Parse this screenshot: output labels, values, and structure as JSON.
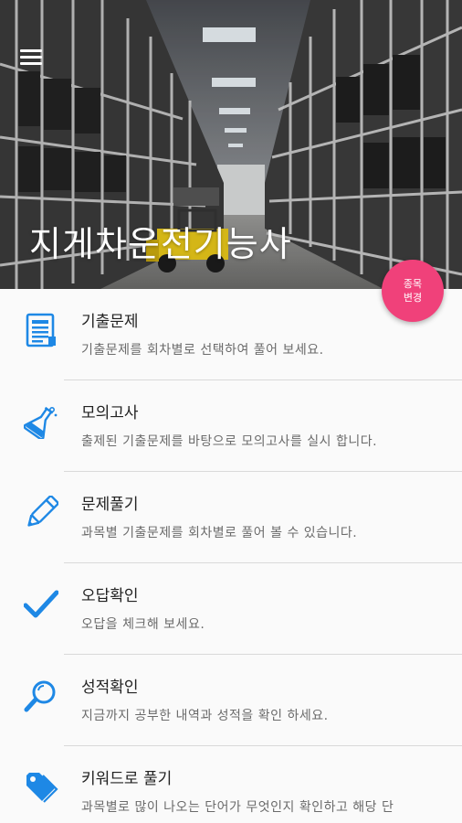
{
  "header": {
    "title": "지게차운전기능사",
    "menu_icon": "hamburger-menu-icon"
  },
  "fab": {
    "line1": "종목",
    "line2": "변경",
    "color": "#f0417a"
  },
  "accent_color": "#1e88e5",
  "menu_items": [
    {
      "title": "기출문제",
      "desc": "기출문제를 회차별로 선택하여 풀어 보세요.",
      "icon": "document-list-icon"
    },
    {
      "title": "모의고사",
      "desc": "출제된 기출문제를 바탕으로 모의고사를 실시 합니다.",
      "icon": "flask-icon"
    },
    {
      "title": "문제풀기",
      "desc": "과목별 기출문제를 회차별로 풀어 볼 수 있습니다.",
      "icon": "pencil-icon"
    },
    {
      "title": "오답확인",
      "desc": "오답을 체크해 보세요.",
      "icon": "checkmark-icon"
    },
    {
      "title": "성적확인",
      "desc": "지금까지 공부한 내역과 성적을 확인 하세요.",
      "icon": "magnifier-icon"
    },
    {
      "title": "키워드로 풀기",
      "desc": "과목별로 많이 나오는 단어가 무엇인지 확인하고 해당 단",
      "icon": "tag-icon"
    }
  ]
}
